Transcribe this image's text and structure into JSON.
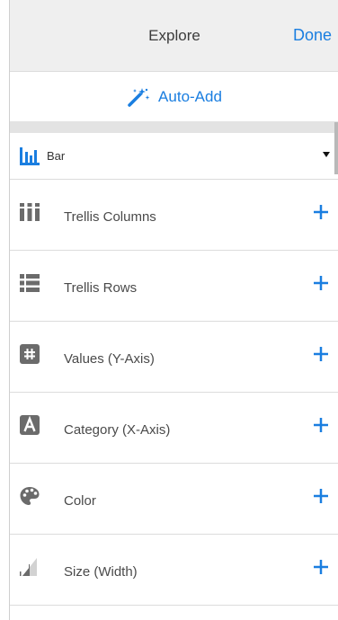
{
  "header": {
    "title": "Explore",
    "done_label": "Done"
  },
  "auto_add": {
    "label": "Auto-Add",
    "icon": "magic-wand-icon"
  },
  "chart_type": {
    "value": "Bar",
    "icon": "bar-chart-icon"
  },
  "drop_targets": [
    {
      "label": "Trellis Columns",
      "icon": "trellis-columns-icon"
    },
    {
      "label": "Trellis Rows",
      "icon": "trellis-rows-icon"
    },
    {
      "label": "Values (Y-Axis)",
      "icon": "hash-icon"
    },
    {
      "label": "Category (X-Axis)",
      "icon": "letter-a-icon"
    },
    {
      "label": "Color",
      "icon": "palette-icon"
    },
    {
      "label": "Size (Width)",
      "icon": "size-width-icon"
    }
  ],
  "colors": {
    "accent": "#1a7ee0",
    "icon_gray": "#6b6b6b",
    "header_bg": "#efefef"
  }
}
